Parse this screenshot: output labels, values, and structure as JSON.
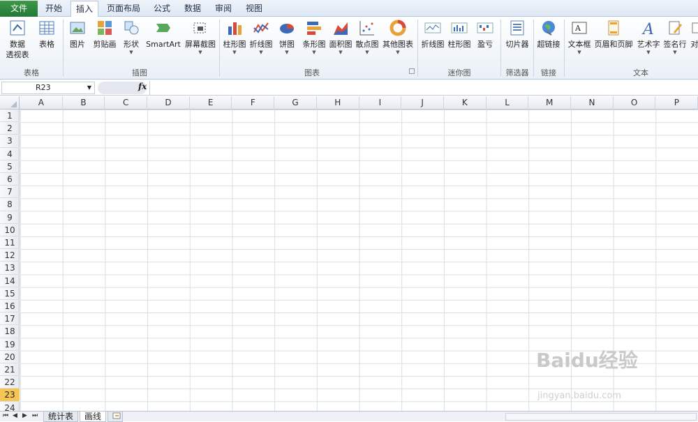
{
  "tabs": {
    "file": "文件",
    "items": [
      "开始",
      "插入",
      "页面布局",
      "公式",
      "数据",
      "审阅",
      "视图"
    ]
  },
  "ribbon": {
    "btn": {
      "pivot": "数据",
      "pivot2": "透视表",
      "table": "表格",
      "picture": "图片",
      "clipart": "剪贴画",
      "shapes": "形状",
      "smartart": "SmartArt",
      "screenshot": "屏幕截图",
      "column": "柱形图",
      "line": "折线图",
      "pie": "饼图",
      "bar": "条形图",
      "area": "面积图",
      "scatter": "散点图",
      "other": "其他图表",
      "spark_line": "折线图",
      "spark_col": "柱形图",
      "spark_wl": "盈亏",
      "slicer": "切片器",
      "hyperlink": "超链接",
      "textbox": "文本框",
      "headerfooter": "页眉和页脚",
      "wordart": "艺术字",
      "signature": "签名行",
      "obj": "对"
    },
    "groups": {
      "tables": "表格",
      "illus": "插图",
      "charts": "图表",
      "spark": "迷你图",
      "filter": "筛选器",
      "links": "链接",
      "text": "文本"
    }
  },
  "formula": {
    "namebox": "R23",
    "fx": "fx",
    "value": ""
  },
  "columns": [
    "A",
    "B",
    "C",
    "D",
    "E",
    "F",
    "G",
    "H",
    "I",
    "J",
    "K",
    "L",
    "M",
    "N",
    "O",
    "P"
  ],
  "rows": [
    "1",
    "2",
    "3",
    "4",
    "5",
    "6",
    "7",
    "8",
    "9",
    "10",
    "11",
    "12",
    "13",
    "14",
    "15",
    "16",
    "17",
    "18",
    "19",
    "20",
    "21",
    "22",
    "23",
    "24"
  ],
  "active_row": "23",
  "sheets": [
    "统计表",
    "画线"
  ],
  "active_sheet": "画线",
  "watermark": {
    "main": "Baidu经验",
    "sub": "jingyan.baidu.com"
  }
}
